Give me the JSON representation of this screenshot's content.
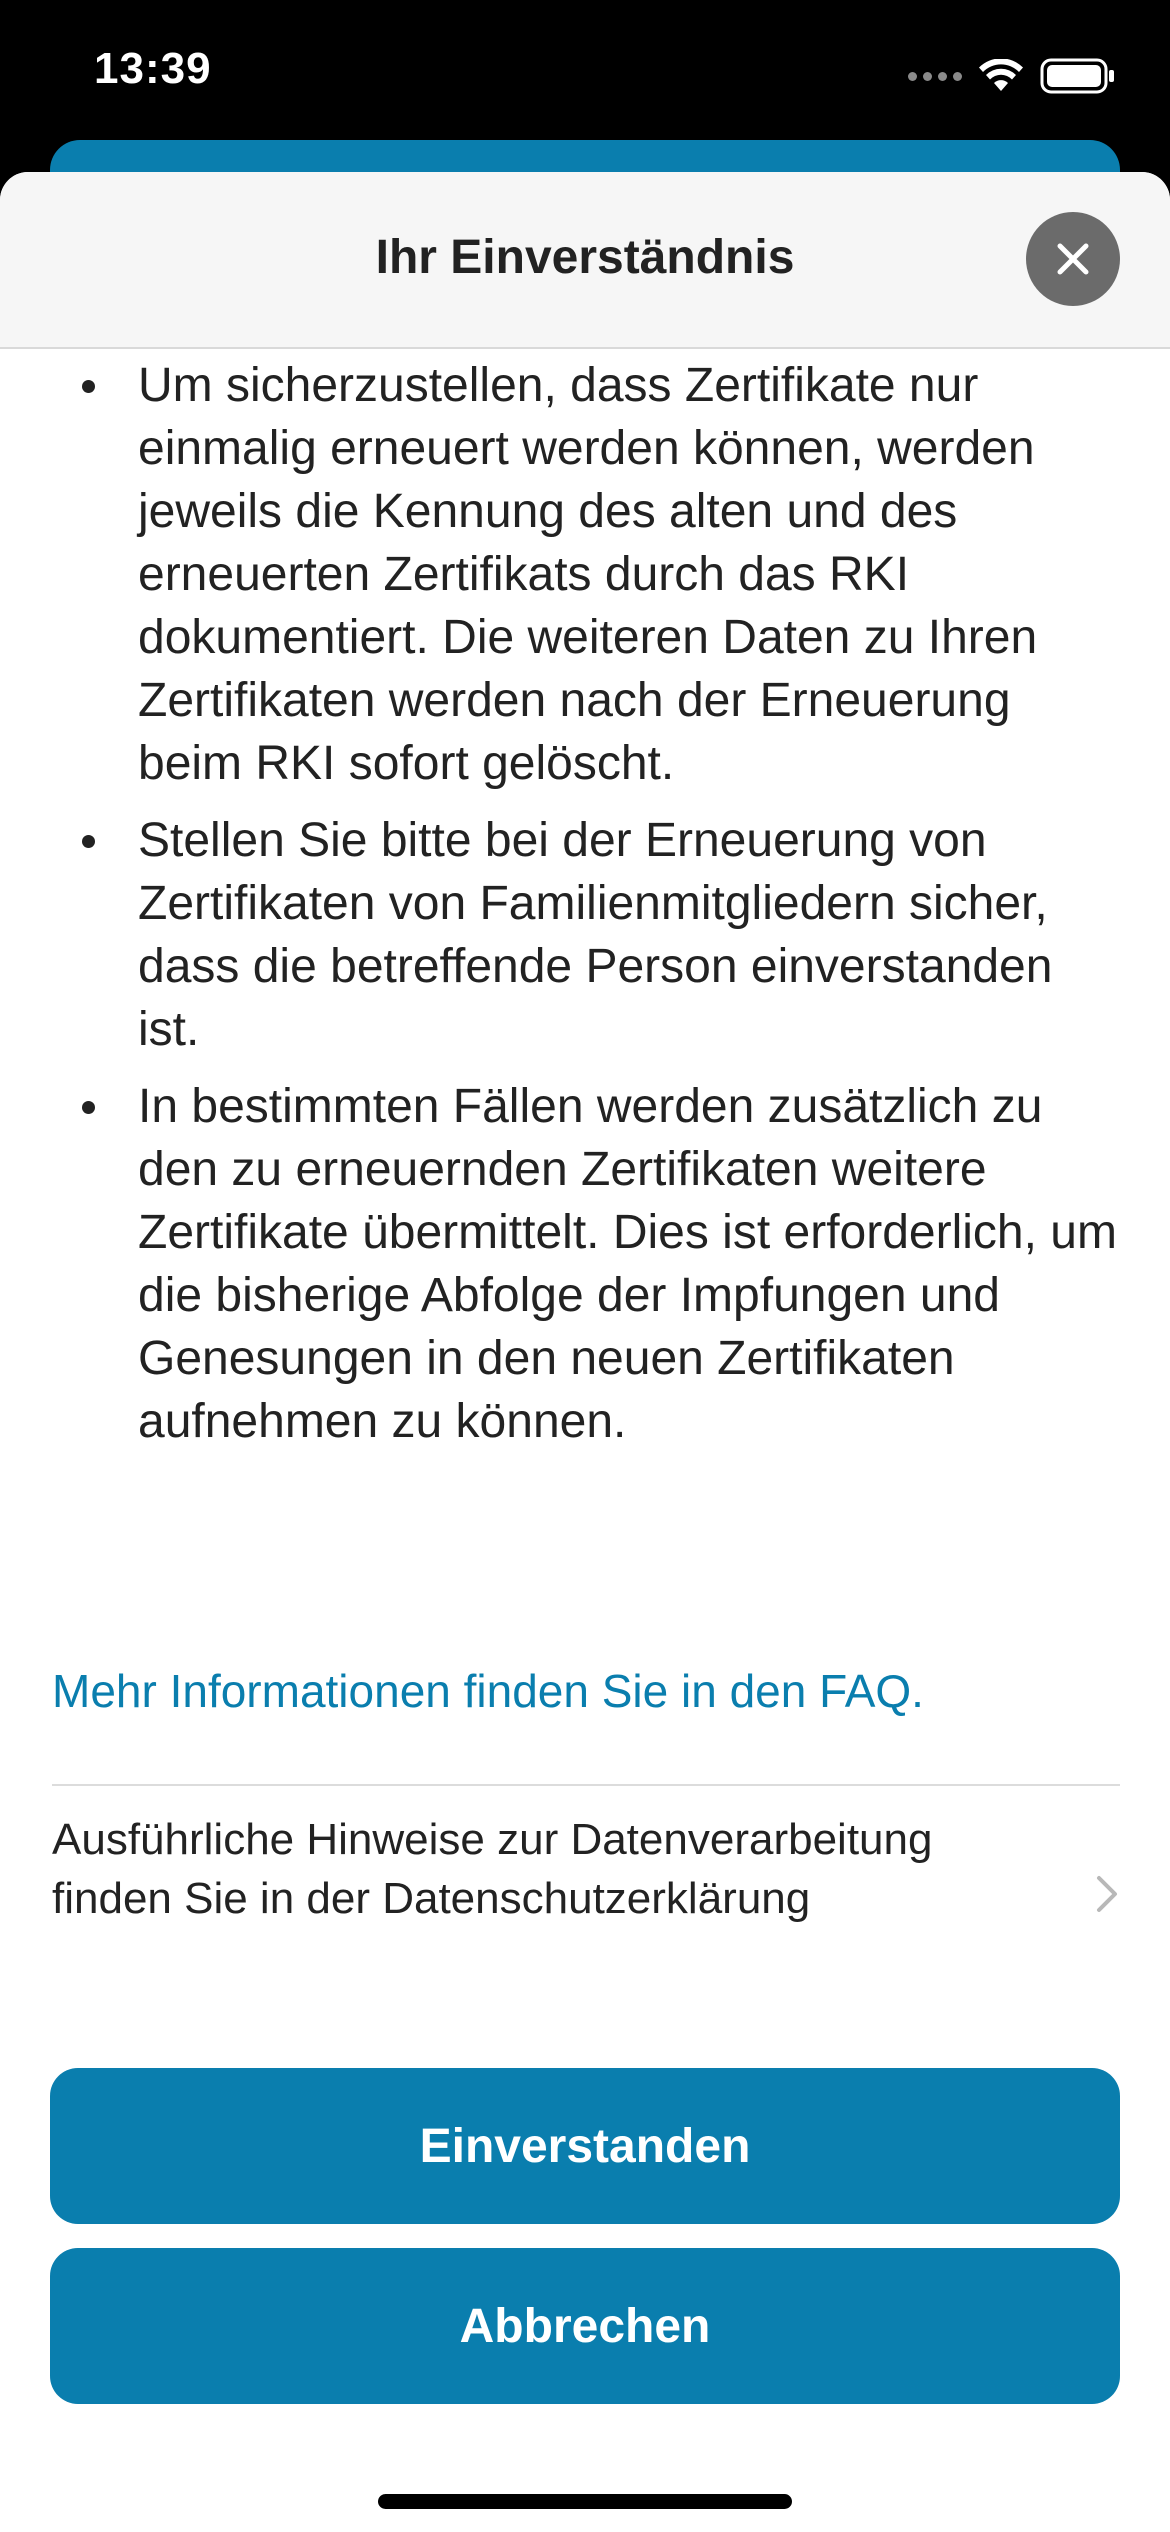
{
  "status_bar": {
    "time": "13:39"
  },
  "sheet": {
    "title": "Ihr Einverständnis",
    "close_icon": "close-icon"
  },
  "bullets": [
    "Um sicherzustellen, dass Zertifikate nur einmalig erneuert werden können, werden jeweils die Kennung des alten und des erneuerten Zertifikats durch das RKI dokumentiert. Die weiteren Daten zu Ihren Zertifikaten werden nach der Erneuerung beim RKI sofort gelöscht.",
    "Stellen Sie bitte bei der Erneuerung von Zertifikaten von Familienmitgliedern sicher, dass die betreffende Person einverstanden ist.",
    "In bestimmten Fällen werden zusätzlich zu den zu erneuernden Zertifikaten weitere Zertifikate übermittelt. Dies ist erforderlich, um die bisherige Abfolge der Impfungen und Genesungen in den neuen Zertifikaten aufnehmen zu können."
  ],
  "faq_link": "Mehr Informationen finden Sie in den FAQ.",
  "privacy": {
    "text": "Ausführliche Hinweise zur Datenverarbeitung finden Sie in der Datenschutzerklärung",
    "chevron_icon": "chevron-right-icon"
  },
  "buttons": {
    "agree": "Einverstanden",
    "cancel": "Abbrechen"
  },
  "colors": {
    "accent": "#0a7eae",
    "text": "#222222",
    "header_bg": "#f6f6f6",
    "close_bg": "#6b6b6b"
  }
}
